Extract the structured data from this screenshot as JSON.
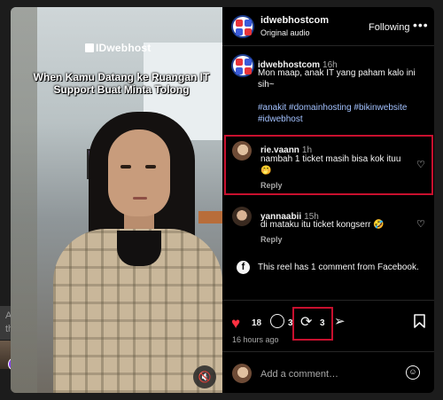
{
  "left_overlay": {
    "thought_placeholder": "Add a thought..."
  },
  "video": {
    "watermark": "IDwebhost",
    "caption": "When Kamu Datang ke Ruangan IT Support Buat Minta Tolong",
    "mute_icon": "speaker-muted-icon"
  },
  "header": {
    "account_name": "idwebhostcom",
    "audio_label": "Original audio",
    "follow_label": "Following",
    "more_icon": "ellipsis-icon"
  },
  "caption_post": {
    "author": "idwebhostcom",
    "time": "16h",
    "text": "Mon maap, anak IT yang paham kalo ini sih~",
    "hashtags": "#anakit #domainhosting #bikinwebsite #idwebhost"
  },
  "comments": [
    {
      "author": "rie.vaann",
      "time": "1h",
      "text": "nambah 1 ticket masih bisa kok ituu 🤭",
      "reply_label": "Reply",
      "highlighted": true
    },
    {
      "author": "yannaabii",
      "time": "15h",
      "text": "di mataku itu ticket kongserr 🤣",
      "reply_label": "Reply",
      "highlighted": false
    }
  ],
  "facebook_note": "This reel has 1 comment from Facebook.",
  "actions": {
    "likes_count": "18",
    "comments_count": "3",
    "reposts_count": "3",
    "time_ago": "16 hours ago"
  },
  "composer": {
    "placeholder": "Add a comment…"
  },
  "colors": {
    "panel_bg": "#000000",
    "hashtag": "#a3c2ff",
    "like_red": "#ff3040",
    "highlight_border": "#c8102e"
  }
}
